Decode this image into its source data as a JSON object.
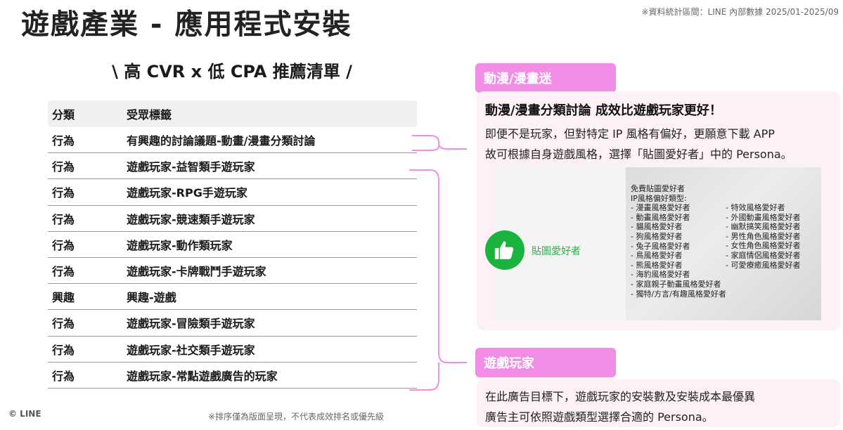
{
  "header": {
    "title": "遊戲產業 - 應用程式安裝",
    "source_note": "※資料統計區間：LINE 內部數據 2025/01-2025/09"
  },
  "subtitle": "\\ 高 CVR x 低 CPA 推薦清單 /",
  "table": {
    "headers": [
      "分類",
      "受眾標籤"
    ],
    "rows": [
      {
        "category": "行為",
        "label": "有興趣的討論議題-動畫/漫畫分類討論"
      },
      {
        "category": "行為",
        "label": "遊戲玩家-益智類手遊玩家"
      },
      {
        "category": "行為",
        "label": "遊戲玩家-RPG手遊玩家"
      },
      {
        "category": "行為",
        "label": "遊戲玩家-競速類手遊玩家"
      },
      {
        "category": "行為",
        "label": "遊戲玩家-動作類玩家"
      },
      {
        "category": "行為",
        "label": "遊戲玩家-卡牌戰鬥手遊玩家"
      },
      {
        "category": "興趣",
        "label": "興趣-遊戲"
      },
      {
        "category": "行為",
        "label": "遊戲玩家-冒險類手遊玩家"
      },
      {
        "category": "行為",
        "label": "遊戲玩家-社交類手遊玩家"
      },
      {
        "category": "行為",
        "label": "遊戲玩家-常點遊戲廣告的玩家"
      }
    ],
    "footnote": "※排序僅為版面呈現，不代表成效排名或優先級"
  },
  "copyright": "© LINE",
  "anime_panel": {
    "tag": "動漫/漫畫迷",
    "heading": "動漫/漫畫分類討論 成效比遊戲玩家更好！",
    "line1": "即便不是玩家，但對特定 IP 風格有偏好，更願意下載 APP",
    "line2": "故可根據自身遊戲風格，選擇「貼圖愛好者」中的 Persona。",
    "sticker": {
      "icon": "thumbs-up-icon",
      "label": "貼圖愛好者",
      "list_title": "免費貼圖愛好者",
      "list_subtitle": "IP風格偏好類型:",
      "left_items": [
        "- 漫畫風格愛好者",
        "- 動畫風格愛好者",
        "- 貓風格愛好者",
        "- 狗風格愛好者",
        "- 兔子風格愛好者",
        "- 鳥風格愛好者",
        "- 熊風格愛好者",
        "- 海豹風格愛好者",
        "- 家庭親子動畫風格愛好者",
        "- 獨特/方言/有趣風格愛好者"
      ],
      "right_items": [
        "- 特效風格愛好者",
        "- 外國動畫風格愛好者",
        "- 幽默搞笑風格愛好者",
        "- 男性角色風格愛好者",
        "- 女性角色風格愛好者",
        "- 家庭情侶風格愛好者",
        "- 可愛療癒風格愛好者"
      ]
    }
  },
  "gamer_panel": {
    "tag": "遊戲玩家",
    "line1": "在此廣告目標下，遊戲玩家的安裝數及安裝成本最優異",
    "line2": "廣告主可依照遊戲類型選擇合適的 Persona。"
  },
  "colors": {
    "accent_pink": "#f28de6",
    "panel_bg": "#fdf0f7",
    "line_green": "#19b33e"
  }
}
